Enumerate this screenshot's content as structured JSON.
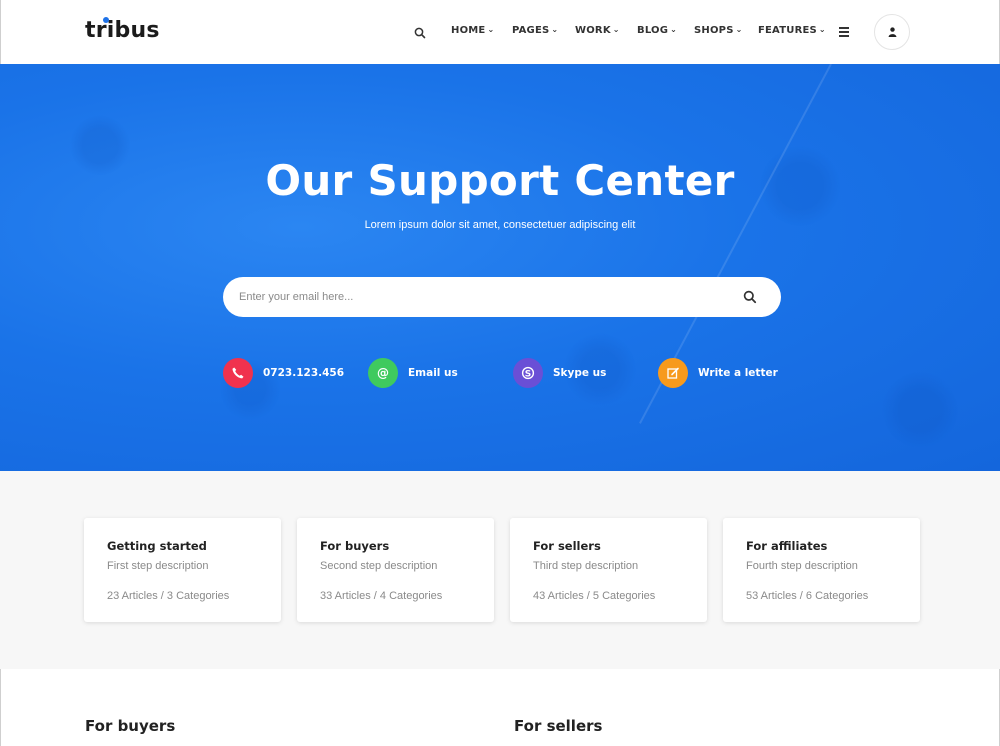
{
  "brand": {
    "name": "tribus",
    "accent": "#1e72e8"
  },
  "nav": {
    "search_icon": "search-icon",
    "items": [
      {
        "label": "HOME"
      },
      {
        "label": "PAGES"
      },
      {
        "label": "WORK"
      },
      {
        "label": "BLOG"
      },
      {
        "label": "SHOPS"
      },
      {
        "label": "FEATURES"
      }
    ],
    "menu_icon": "hamburger-icon",
    "user_icon": "user-icon"
  },
  "hero": {
    "title": "Our Support Center",
    "subtitle": "Lorem ipsum dolor sit amet, consectetuer adipiscing elit",
    "background": "#1a73e8",
    "search": {
      "placeholder": "Enter your email here...",
      "value": ""
    },
    "contacts": [
      {
        "label": "0723.123.456",
        "icon": "phone-icon",
        "color": "#f0324e"
      },
      {
        "label": "Email us",
        "icon": "at-icon",
        "color": "#3fca5e"
      },
      {
        "label": "Skype us",
        "icon": "skype-icon",
        "color": "#6a4fd6"
      },
      {
        "label": "Write a letter",
        "icon": "edit-icon",
        "color": "#f79a1c"
      }
    ]
  },
  "cards": [
    {
      "title": "Getting started",
      "desc": "First step description",
      "stats": "23 Articles / 3 Categories"
    },
    {
      "title": "For buyers",
      "desc": "Second step description",
      "stats": "33 Articles / 4 Categories"
    },
    {
      "title": "For sellers",
      "desc": "Third step description",
      "stats": "43 Articles / 5 Categories"
    },
    {
      "title": "For affiliates",
      "desc": "Fourth step description",
      "stats": "53 Articles / 6 Categories"
    }
  ],
  "sections": [
    {
      "title": "For buyers"
    },
    {
      "title": "For sellers"
    }
  ]
}
